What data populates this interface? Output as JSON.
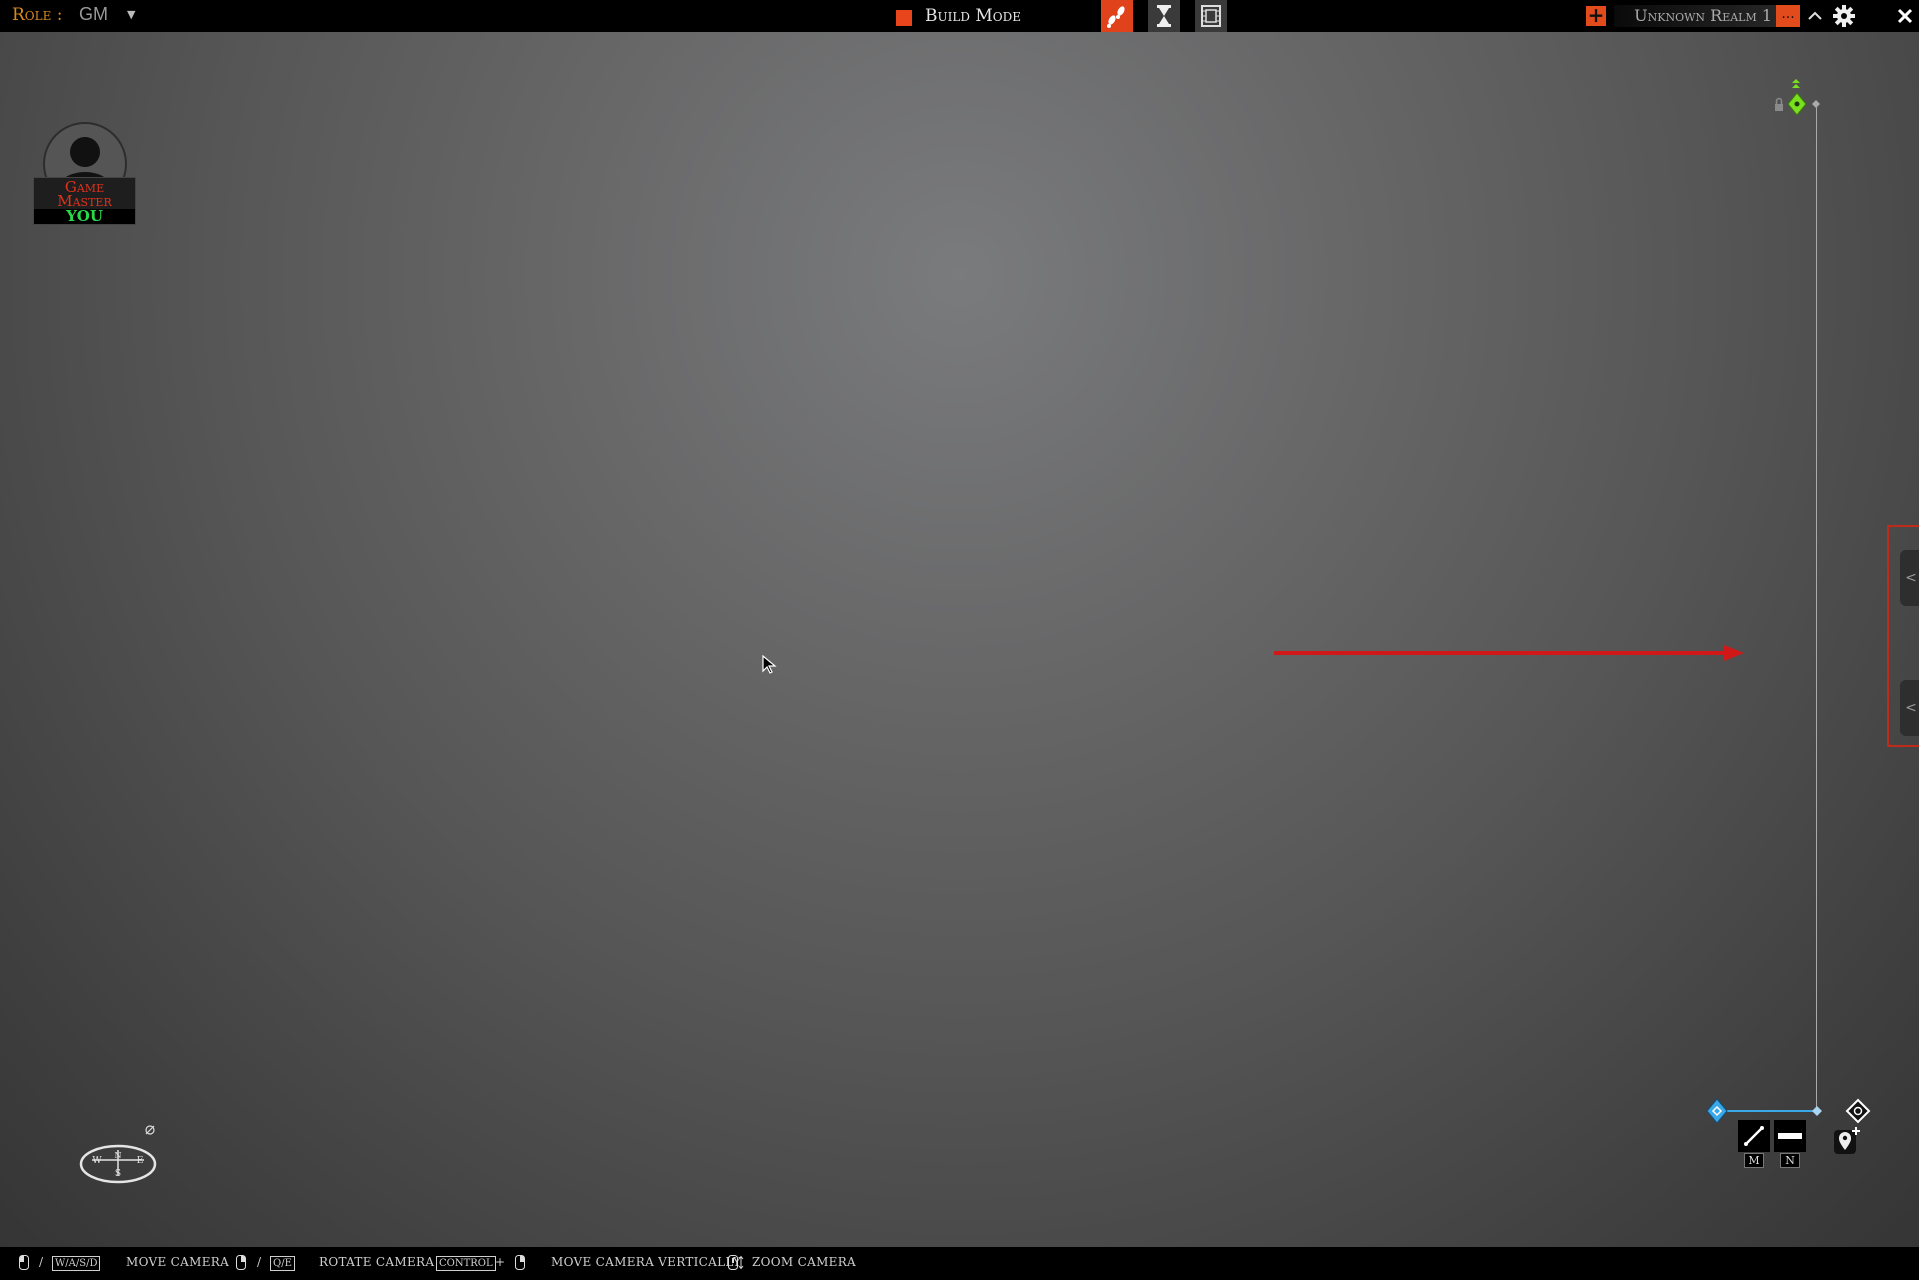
{
  "topbar": {
    "role_label": "Role :",
    "role_value": "GM",
    "role_dropdown_icon": "caret-down-icon",
    "build_mode_label": "Build Mode",
    "build_mode_color": "#e8451d",
    "mode_buttons": [
      {
        "name": "walk-mode",
        "icon": "footsteps-icon",
        "active": true
      },
      {
        "name": "time-mode",
        "icon": "hourglass-icon",
        "active": false
      },
      {
        "name": "cinematic-mode",
        "icon": "film-icon",
        "active": false
      }
    ],
    "realm_name": "Unknown Realm 1",
    "realm_more_label": "...",
    "add_realm_icon": "plus-icon",
    "collapse_icon": "chevron-up-icon",
    "settings_icon": "gear-icon",
    "close_icon": "close-icon",
    "accent_color": "#e24b1c"
  },
  "player_card": {
    "role_line1": "Game",
    "role_line2": "Master",
    "player_name": "YOU",
    "name_color": "#29d94a",
    "role_color": "#e0321c"
  },
  "map_tools": {
    "line_tool_key": "M",
    "flat_tool_key": "N",
    "line_tool_icon": "diagonal-line-icon",
    "flat_tool_icon": "horizontal-bar-icon",
    "add_marker_icon": "map-pin-plus-icon",
    "lock_icon": "lock-icon",
    "anchor_icon": "green-diamond-icon",
    "origin_icon": "blue-diamond-icon",
    "target_icon": "white-diamond-icon"
  },
  "side_panel": {
    "upper_tab_glyph": "<",
    "lower_tab_glyph": "<"
  },
  "compass": {
    "icon": "compass-icon",
    "letters": [
      "N",
      "E",
      "S",
      "W"
    ]
  },
  "bottombar": {
    "move_keys": "W/A/S/D",
    "move_label": "MOVE CAMERA",
    "rotate_keys": "Q/E",
    "rotate_label": "ROTATE CAMERA",
    "vertical_key": "CONTROL",
    "plus": "+",
    "vertical_label": "MOVE CAMERA VERTICALLY",
    "zoom_label": "ZOOM CAMERA",
    "slash": "/"
  }
}
